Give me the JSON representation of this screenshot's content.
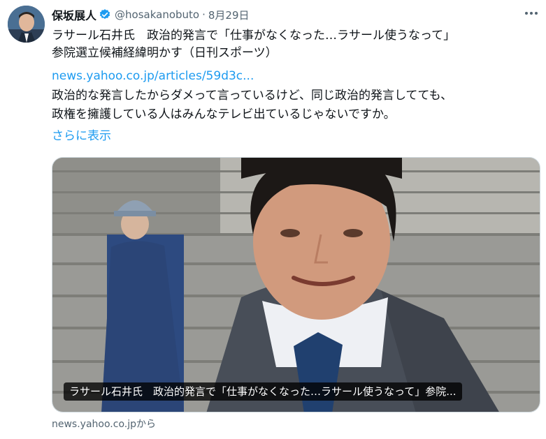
{
  "author": {
    "display_name": "保坂展人",
    "handle": "@hosakanobuto",
    "separator": "·",
    "date": "8月29日",
    "verified_icon": "verified-badge-icon"
  },
  "tweet": {
    "line1": "ラサール石井氏　政治的発言で「仕事がなくなった…ラサール使うなって」",
    "line2": "参院選立候補経緯明かす（日刊スポーツ）",
    "link": "news.yahoo.co.jp/articles/59d3c...",
    "line4": "政治的な発言したからダメって言っているけど、同じ政治的発言してても、",
    "line5": "政権を擁護している人はみんなテレビ出ているじゃないですか。",
    "show_more": "さらに表示"
  },
  "card": {
    "caption": "ラサール石井氏　政治的発言で「仕事がなくなった…ラサール使うなって」参院...",
    "source": "news.yahoo.co.jpから"
  },
  "colors": {
    "link": "#1d9bf0",
    "secondary_text": "#536471",
    "verified": "#1d9bf0"
  }
}
